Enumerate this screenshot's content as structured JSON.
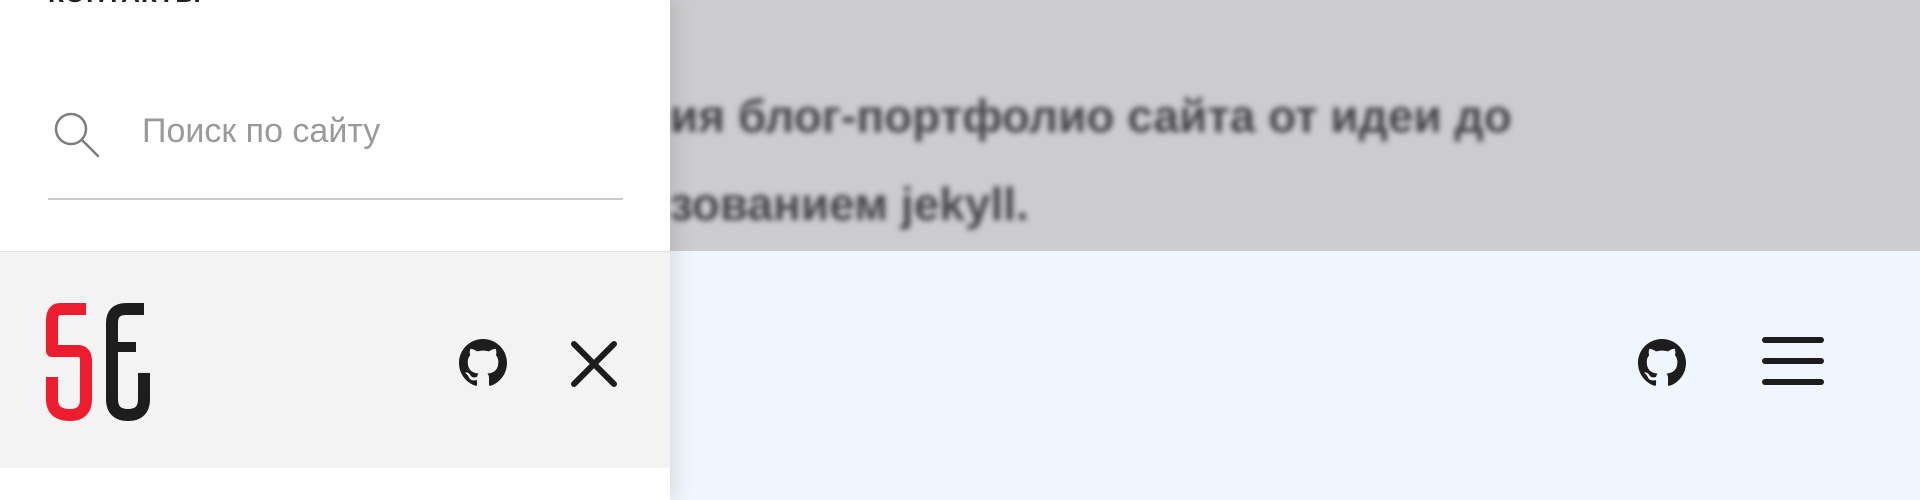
{
  "page": {
    "text_line1": "ия блог-портфолио сайта от идеи до",
    "text_line2": "зованием jekyll."
  },
  "side_panel": {
    "heading": "КОНТАКТЫ",
    "search": {
      "placeholder": "Поиск по сайту",
      "value": ""
    },
    "logo_icon": "sf-logo",
    "github_icon": "github-icon",
    "close_icon": "close-icon"
  },
  "header": {
    "github_icon": "github-icon",
    "menu_icon": "hamburger-menu-icon"
  },
  "colors": {
    "logo_red": "#ed1c2e",
    "logo_dark": "#1d1d1d",
    "header_bg": "#f0f6fd",
    "panel_bar_bg": "#f3f3f3"
  }
}
